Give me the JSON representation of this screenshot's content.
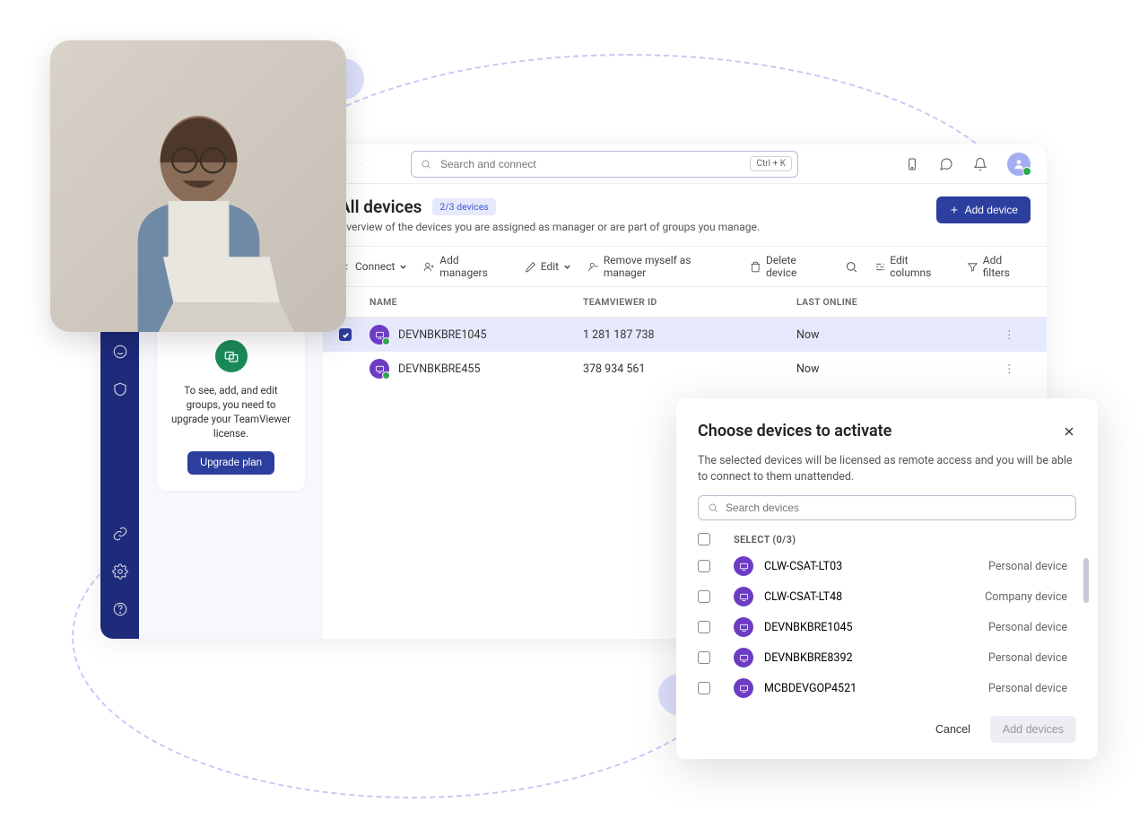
{
  "header": {
    "search_placeholder": "Search and connect",
    "shortcut": "Ctrl + K"
  },
  "page": {
    "title": "All devices",
    "badge": "2/3 devices",
    "subtitle": "Overview of the devices you are assigned as manager or are part of groups you manage.",
    "add_device": "Add device"
  },
  "toolbar": {
    "connect": "Connect",
    "add_managers": "Add managers",
    "edit": "Edit",
    "remove_self": "Remove myself as manager",
    "delete": "Delete device",
    "edit_columns": "Edit columns",
    "add_filters": "Add filters"
  },
  "columns": {
    "name": "NAME",
    "tv_id": "TEAMVIEWER ID",
    "last_online": "LAST ONLINE"
  },
  "rows": [
    {
      "name": "DEVNBKBRE1045",
      "tv_id": "1 281 187 738",
      "last_online": "Now",
      "selected": true
    },
    {
      "name": "DEVNBKBRE455",
      "tv_id": "378 934 561",
      "last_online": "Now",
      "selected": false
    }
  ],
  "upgrade": {
    "text": "To see, add, and edit groups, you need to upgrade your TeamViewer license.",
    "button": "Upgrade plan"
  },
  "modal": {
    "title": "Choose devices to activate",
    "desc": "The selected devices will be licensed as remote access and you will be able to connect to them unattended.",
    "search_placeholder": "Search devices",
    "select_label": "SELECT (0/3)",
    "rows": [
      {
        "name": "CLW-CSAT-LT03",
        "type": "Personal device"
      },
      {
        "name": "CLW-CSAT-LT48",
        "type": "Company device"
      },
      {
        "name": "DEVNBKBRE1045",
        "type": "Personal device"
      },
      {
        "name": "DEVNBKBRE8392",
        "type": "Personal device"
      },
      {
        "name": "MCBDEVGOP4521",
        "type": "Personal device"
      }
    ],
    "cancel": "Cancel",
    "add": "Add devices"
  }
}
